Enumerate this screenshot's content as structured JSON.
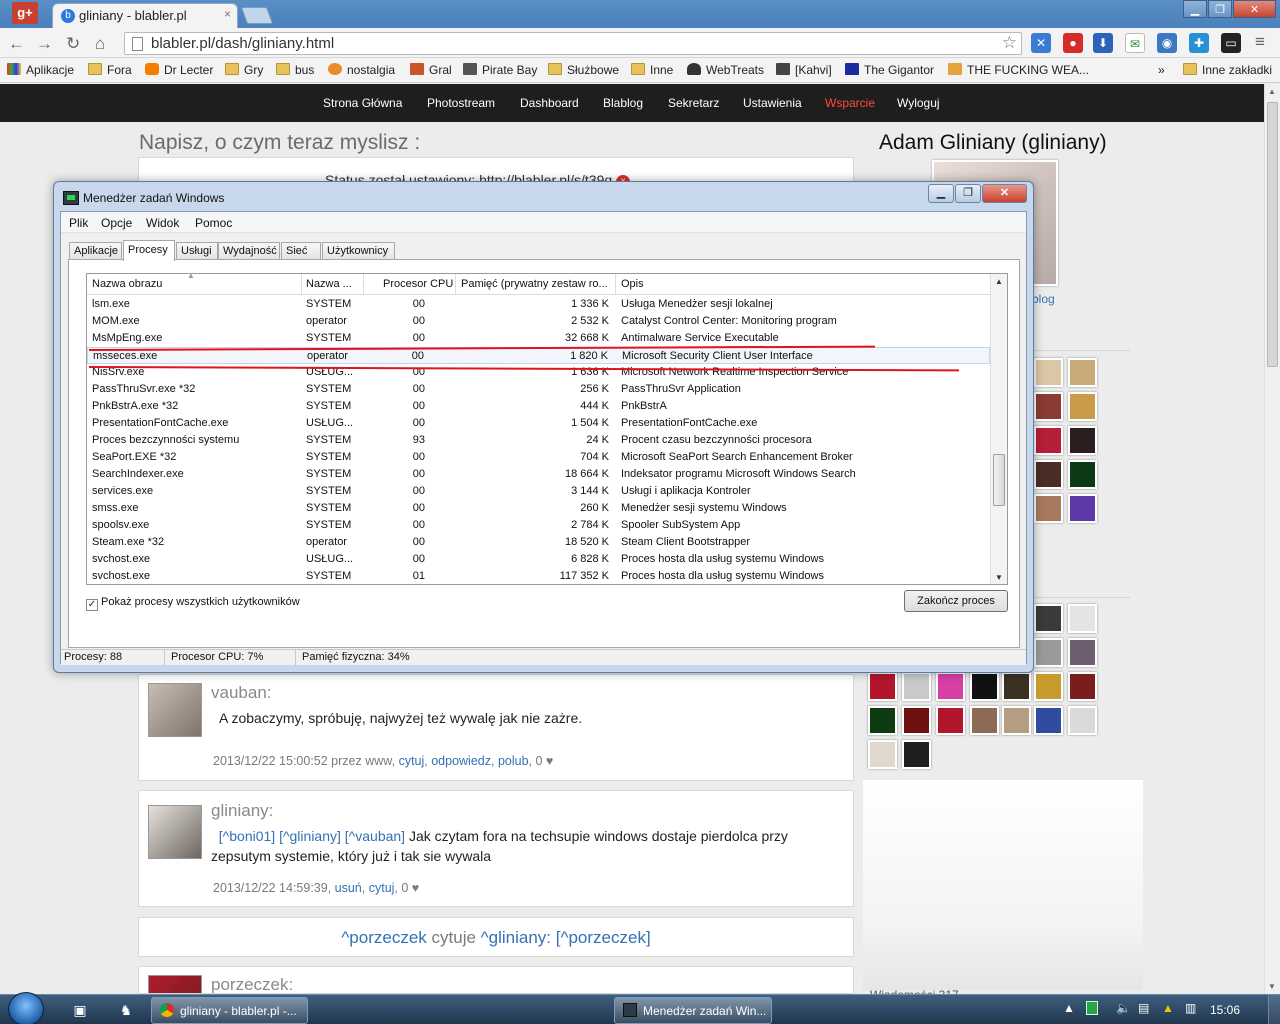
{
  "browser": {
    "tab_title": "gliniany - blabler.pl",
    "tab_close": "×",
    "url": "blabler.pl/dash/gliniany.html",
    "gplus": "g+",
    "bookmarks": [
      {
        "label": "Aplikacje",
        "icon": "apps-icon"
      },
      {
        "label": "Fora",
        "icon": "folder-icon"
      },
      {
        "label": "Dr Lecter",
        "icon": "blogger-icon"
      },
      {
        "label": "Gry",
        "icon": "folder-icon"
      },
      {
        "label": "bus",
        "icon": "folder-icon"
      },
      {
        "label": "nostalgia",
        "icon": "sun-icon"
      },
      {
        "label": "Gral",
        "icon": "fox-icon"
      },
      {
        "label": "Pirate Bay",
        "icon": "ship-icon"
      },
      {
        "label": "Służbowe",
        "icon": "folder-icon"
      },
      {
        "label": "Inne",
        "icon": "folder-icon"
      },
      {
        "label": "WebTreats",
        "icon": "person-icon"
      },
      {
        "label": "[Kahvi]",
        "icon": "k-icon"
      },
      {
        "label": "The Gigantor",
        "icon": "play-icon"
      },
      {
        "label": "THE FUCKING WEA...",
        "icon": "weather-icon"
      }
    ],
    "bookmarks_more": "»",
    "other_bookmarks": "Inne zakładki"
  },
  "site_nav": [
    {
      "label": "Strona Główna"
    },
    {
      "label": "Photostream"
    },
    {
      "label": "Dashboard"
    },
    {
      "label": "Blablog"
    },
    {
      "label": "Sekretarz"
    },
    {
      "label": "Ustawienia"
    },
    {
      "label": "Wsparcie",
      "highlight": true
    },
    {
      "label": "Wyloguj"
    }
  ],
  "page": {
    "heading": "Napisz, o czym teraz myslisz :",
    "status_message": "Status został ustawiony: http://blabler.pl/s/t39q",
    "status_close": "×",
    "profile_name": "Adam Gliniany (gliniany)",
    "profile_link": "blog"
  },
  "comments": [
    {
      "author": "vauban:",
      "text": "A zobaczymy, spróbuję, najwyżej też wywalę jak nie zażre.",
      "meta_prefix": "2013/12/22 15:00:52 przez www,",
      "links": [
        "cytuj",
        "odpowiedz",
        "polub"
      ],
      "likes": "0 ♥"
    },
    {
      "author": "gliniany:",
      "mentions": [
        "[^boni01]",
        "[^gliniany]",
        "[^vauban]"
      ],
      "text": "Jak czytam fora na techsupie windows dostaje pierdolca przy zepsutym systemie, który już i tak sie wywala",
      "meta_prefix": "2013/12/22 14:59:39,",
      "links": [
        "usuń",
        "cytuj"
      ],
      "likes": "0 ♥"
    },
    {
      "quote_user": "^porzeczek",
      "quote_mid": "cytuje",
      "quote_target": "^gliniany:",
      "quote_ref": "[^porzeczek]"
    },
    {
      "author": "porzeczek:"
    }
  ],
  "sidebar_footer": "Wiadomości 317",
  "task_manager": {
    "title": "Menedżer zadań Windows",
    "menu": [
      "Plik",
      "Opcje",
      "Widok",
      "Pomoc"
    ],
    "tabs": [
      "Aplikacje",
      "Procesy",
      "Usługi",
      "Wydajność",
      "Sieć",
      "Użytkownicy"
    ],
    "active_tab": "Procesy",
    "columns": [
      "Nazwa obrazu",
      "Nazwa ...",
      "Procesor CPU",
      "Pamięć (prywatny zestaw ro...",
      "Opis"
    ],
    "processes": [
      {
        "name": "lsm.exe",
        "user": "SYSTEM",
        "cpu": "00",
        "mem": "1 336 K",
        "desc": "Usługa Menedżer sesji lokalnej"
      },
      {
        "name": "MOM.exe",
        "user": "operator",
        "cpu": "00",
        "mem": "2 532 K",
        "desc": "Catalyst Control Center: Monitoring program"
      },
      {
        "name": "MsMpEng.exe",
        "user": "SYSTEM",
        "cpu": "00",
        "mem": "32 668 K",
        "desc": "Antimalware Service Executable"
      },
      {
        "name": "msseces.exe",
        "user": "operator",
        "cpu": "00",
        "mem": "1 820 K",
        "desc": "Microsoft Security Client User Interface",
        "selected": true
      },
      {
        "name": "NisSrv.exe",
        "user": "USŁUG...",
        "cpu": "00",
        "mem": "1 636 K",
        "desc": "Microsoft Network Realtime Inspection Service"
      },
      {
        "name": "PassThruSvr.exe *32",
        "user": "SYSTEM",
        "cpu": "00",
        "mem": "256 K",
        "desc": "PassThruSvr Application"
      },
      {
        "name": "PnkBstrA.exe *32",
        "user": "SYSTEM",
        "cpu": "00",
        "mem": "444 K",
        "desc": "PnkBstrA"
      },
      {
        "name": "PresentationFontCache.exe",
        "user": "USŁUG...",
        "cpu": "00",
        "mem": "1 504 K",
        "desc": "PresentationFontCache.exe"
      },
      {
        "name": "Proces bezczynności systemu",
        "user": "SYSTEM",
        "cpu": "93",
        "mem": "24 K",
        "desc": "Procent czasu bezczynności procesora"
      },
      {
        "name": "SeaPort.EXE *32",
        "user": "SYSTEM",
        "cpu": "00",
        "mem": "704 K",
        "desc": "Microsoft SeaPort Search Enhancement Broker"
      },
      {
        "name": "SearchIndexer.exe",
        "user": "SYSTEM",
        "cpu": "00",
        "mem": "18 664 K",
        "desc": "Indeksator programu Microsoft Windows Search"
      },
      {
        "name": "services.exe",
        "user": "SYSTEM",
        "cpu": "00",
        "mem": "3 144 K",
        "desc": "Usługi i aplikacja Kontroler"
      },
      {
        "name": "smss.exe",
        "user": "SYSTEM",
        "cpu": "00",
        "mem": "260 K",
        "desc": "Menedżer sesji systemu Windows"
      },
      {
        "name": "spoolsv.exe",
        "user": "SYSTEM",
        "cpu": "00",
        "mem": "2 784 K",
        "desc": "Spooler SubSystem App"
      },
      {
        "name": "Steam.exe *32",
        "user": "operator",
        "cpu": "00",
        "mem": "18 520 K",
        "desc": "Steam Client Bootstrapper"
      },
      {
        "name": "svchost.exe",
        "user": "USŁUG...",
        "cpu": "00",
        "mem": "6 828 K",
        "desc": "Proces hosta dla usług systemu Windows"
      },
      {
        "name": "svchost.exe",
        "user": "SYSTEM",
        "cpu": "01",
        "mem": "117 352 K",
        "desc": "Proces hosta dla usług systemu Windows"
      }
    ],
    "show_all_label": "Pokaż procesy wszystkich użytkowników",
    "show_all_checked": true,
    "end_process": "Zakończ proces",
    "status": {
      "processes": "Procesy: 88",
      "cpu": "Procesor CPU: 7%",
      "memory": "Pamięć fizyczna: 34%"
    },
    "annotation_color": "#e0151b"
  },
  "taskbar": {
    "tasks": [
      {
        "label": "gliniany - blabler.pl -...",
        "icon": "chrome-icon"
      },
      {
        "label": "Menedżer zadań Win...",
        "icon": "task-manager-icon"
      }
    ],
    "clock": "15:06"
  }
}
